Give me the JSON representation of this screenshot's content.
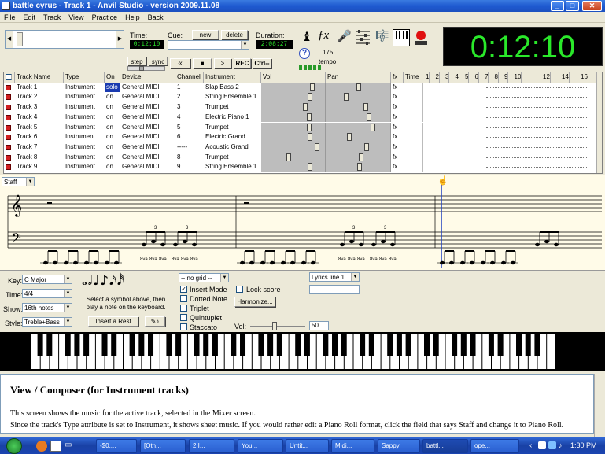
{
  "window": {
    "title": "battle cyrus - Track 1 - Anvil Studio - version 2009.11.08",
    "btn_min": "_",
    "btn_max": "□",
    "btn_close": "✕"
  },
  "menu": [
    "File",
    "Edit",
    "Track",
    "View",
    "Practice",
    "Help",
    "Back"
  ],
  "toolbar": {
    "time_label": "Time:",
    "time_value": "0:12:10",
    "cue_label": "Cue:",
    "cue_new": "new",
    "cue_delete": "delete",
    "duration_label": "Duration:",
    "duration_value": "2:08:27",
    "step": "step",
    "sync": "sync",
    "rew": "«",
    "stop": "■",
    "play": ">",
    "rec": "REC",
    "ctrl": "Ctrl--",
    "tempo_value": "175",
    "tempo_label": "tempo",
    "help_q": "?"
  },
  "big_time": "0:12:10",
  "tracks": {
    "headers": [
      "Track Name",
      "Type",
      "On",
      "Device",
      "Channel",
      "Instrument",
      "Vol",
      "Pan",
      "fx",
      "Time"
    ],
    "time_ticks": [
      "1",
      "2",
      "3",
      "4",
      "5",
      "6",
      "7",
      "8",
      "9",
      "10",
      "12",
      "14",
      "16"
    ],
    "rows": [
      {
        "name": "Track 1",
        "type": "Instrument",
        "on": "solo",
        "device": "General MIDI",
        "channel": "1",
        "instrument": "Slap Bass 2",
        "fx": "fx",
        "vol": 0.82,
        "pan": 0.5
      },
      {
        "name": "Track 2",
        "type": "Instrument",
        "on": "on",
        "device": "General MIDI",
        "channel": "2",
        "instrument": "String Ensemble 1",
        "fx": "fx",
        "vol": 0.78,
        "pan": 0.3
      },
      {
        "name": "Track 3",
        "type": "Instrument",
        "on": "on",
        "device": "General MIDI",
        "channel": "3",
        "instrument": "Trumpet",
        "fx": "fx",
        "vol": 0.7,
        "pan": 0.62
      },
      {
        "name": "Track 4",
        "type": "Instrument",
        "on": "on",
        "device": "General MIDI",
        "channel": "4",
        "instrument": "Electric Piano 1",
        "fx": "fx",
        "vol": 0.76,
        "pan": 0.68
      },
      {
        "name": "Track 5",
        "type": "Instrument",
        "on": "on",
        "device": "General MIDI",
        "channel": "5",
        "instrument": "Trumpet",
        "fx": "fx",
        "vol": 0.76,
        "pan": 0.74
      },
      {
        "name": "Track 6",
        "type": "Instrument",
        "on": "on",
        "device": "General MIDI",
        "channel": "6",
        "instrument": "Electric Grand",
        "fx": "fx",
        "vol": 0.78,
        "pan": 0.35
      },
      {
        "name": "Track 7",
        "type": "Instrument",
        "on": "on",
        "device": "General MIDI",
        "channel": "-----",
        "instrument": "Acoustic Grand",
        "fx": "fx",
        "vol": 0.9,
        "pan": 0.64
      },
      {
        "name": "Track 8",
        "type": "Instrument",
        "on": "on",
        "device": "General MIDI",
        "channel": "8",
        "instrument": "Trumpet",
        "fx": "fx",
        "vol": 0.42,
        "pan": 0.55
      },
      {
        "name": "Track 9",
        "type": "Instrument",
        "on": "on",
        "device": "General MIDI",
        "channel": "9",
        "instrument": "String Ensemble 1",
        "fx": "fx",
        "vol": 0.78,
        "pan": 0.52
      }
    ]
  },
  "staff": {
    "view_select": "Staff",
    "octave_mark": "8va",
    "triplet_mark": "3"
  },
  "composer": {
    "key_label": "Key:",
    "key_value": "C Major",
    "time_label": "Time:",
    "time_value": "4/4",
    "show_label": "Show:",
    "show_value": "16th notes",
    "style_label": "Style:",
    "style_value": "Treble+Bass",
    "symbol_hint": "Select a symbol above, then play a note on the keyboard.",
    "insert_rest": "Insert a Rest",
    "grid_value": "-- no grid --",
    "insert_mode": "Insert Mode",
    "dotted_note": "Dotted Note",
    "triplet": "Triplet",
    "quintuplet": "Quintuplet",
    "staccato": "Staccato",
    "lock_score": "Lock score",
    "harmonize": "Harmonize...",
    "vol_label": "Vol:",
    "vol_value": "50",
    "lyrics_value": "Lyrics line 1"
  },
  "help": {
    "heading": "View / Composer (for Instrument tracks)",
    "p1": "This screen shows the music for the active track, selected in the Mixer screen.",
    "p2": "Since the track's Type attribute is set to Instrument, it shows sheet music.  If you would rather edit a Piano Roll format, click the field that says Staff and change it to Piano Roll."
  },
  "taskbar": {
    "tasks": [
      "-$0,...",
      "[Oth...",
      "2 I...",
      "You...",
      "Untit...",
      "Midi...",
      "Sappy",
      "battl...",
      "ope..."
    ],
    "clock": "1:30 PM"
  }
}
